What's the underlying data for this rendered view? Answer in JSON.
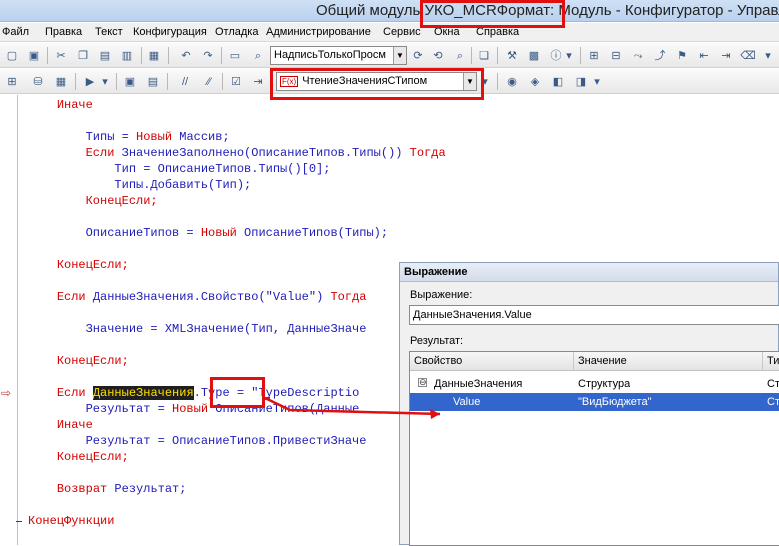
{
  "window": {
    "title": "Общий модуль УКО_MCRФормат: Модуль - Конфигуратор - Управлен"
  },
  "menu": [
    {
      "name": "menu-file",
      "label": "Файл"
    },
    {
      "name": "menu-edit",
      "label": "Правка"
    },
    {
      "name": "menu-text",
      "label": "Текст"
    },
    {
      "name": "menu-config",
      "label": "Конфигурация"
    },
    {
      "name": "menu-debug",
      "label": "Отладка"
    },
    {
      "name": "menu-admin",
      "label": "Администрирование"
    },
    {
      "name": "menu-service",
      "label": "Сервис"
    },
    {
      "name": "menu-windows",
      "label": "Окна"
    },
    {
      "name": "menu-help",
      "label": "Справка"
    }
  ],
  "toolbar": {
    "search_value": "НадписьТолькоПросм",
    "procedure_value": "ЧтениеЗначенияСТипом",
    "procedure_icon_text": "F(x)"
  },
  "code": {
    "lines": [
      {
        "indent": "    ",
        "parts": [
          {
            "t": "Иначе",
            "k": true
          }
        ]
      },
      {
        "indent": "",
        "parts": []
      },
      {
        "indent": "        ",
        "parts": [
          {
            "t": "Типы = ",
            "k": false
          },
          {
            "t": "Новый",
            "k": true
          },
          {
            "t": " Массив;",
            "k": false
          }
        ]
      },
      {
        "indent": "        ",
        "parts": [
          {
            "t": "Если",
            "k": true
          },
          {
            "t": " ЗначениеЗаполнено(ОписаниеТипов.Типы()) ",
            "k": false
          },
          {
            "t": "Тогда",
            "k": true
          }
        ]
      },
      {
        "indent": "            ",
        "parts": [
          {
            "t": "Тип = ОписаниеТипов.Типы()[0];",
            "k": false
          }
        ]
      },
      {
        "indent": "            ",
        "parts": [
          {
            "t": "Типы.Добавить(Тип);",
            "k": false
          }
        ]
      },
      {
        "indent": "        ",
        "parts": [
          {
            "t": "КонецЕсли;",
            "k": true
          }
        ]
      },
      {
        "indent": "",
        "parts": []
      },
      {
        "indent": "        ",
        "parts": [
          {
            "t": "ОписаниеТипов = ",
            "k": false
          },
          {
            "t": "Новый",
            "k": true
          },
          {
            "t": " ОписаниеТипов(Типы);",
            "k": false
          }
        ]
      },
      {
        "indent": "",
        "parts": []
      },
      {
        "indent": "    ",
        "parts": [
          {
            "t": "КонецЕсли;",
            "k": true
          }
        ]
      },
      {
        "indent": "",
        "parts": []
      },
      {
        "indent": "    ",
        "parts": [
          {
            "t": "Если",
            "k": true
          },
          {
            "t": " ДанныеЗначения.Свойство(",
            "k": false
          },
          {
            "t": "\"Value\"",
            "k": false
          },
          {
            "t": ") ",
            "k": false
          },
          {
            "t": "Тогда",
            "k": true
          }
        ]
      },
      {
        "indent": "",
        "parts": []
      },
      {
        "indent": "        ",
        "parts": [
          {
            "t": "Значение = XMLЗначение(Тип, ДанныеЗначе",
            "k": false
          }
        ]
      },
      {
        "indent": "",
        "parts": []
      },
      {
        "indent": "    ",
        "parts": [
          {
            "t": "КонецЕсли;",
            "k": true
          }
        ]
      },
      {
        "indent": "",
        "parts": []
      },
      {
        "indent": "    ",
        "parts": [
          {
            "t": "Если",
            "k": true
          },
          {
            "t": " ",
            "k": false
          },
          {
            "t": "ДанныеЗначения",
            "k": false,
            "h": true
          },
          {
            "t": ".Type = \"TypeDescriptio",
            "k": false
          }
        ]
      },
      {
        "indent": "        ",
        "parts": [
          {
            "t": "Результат = ",
            "k": false
          },
          {
            "t": "Новый",
            "k": true
          },
          {
            "t": " ОписаниеТипов(Данные",
            "k": false
          }
        ]
      },
      {
        "indent": "    ",
        "parts": [
          {
            "t": "Иначе",
            "k": true
          }
        ]
      },
      {
        "indent": "        ",
        "parts": [
          {
            "t": "Результат = ОписаниеТипов.ПривестиЗначе",
            "k": false
          }
        ]
      },
      {
        "indent": "    ",
        "parts": [
          {
            "t": "КонецЕсли;",
            "k": true
          }
        ]
      },
      {
        "indent": "",
        "parts": []
      },
      {
        "indent": "    ",
        "parts": [
          {
            "t": "Возврат",
            "k": true
          },
          {
            "t": " Результат;",
            "k": false
          }
        ]
      },
      {
        "indent": "",
        "parts": []
      },
      {
        "indent": "",
        "parts": [
          {
            "t": "КонецФункции",
            "k": true
          }
        ]
      }
    ]
  },
  "dialog": {
    "title": "Выражение",
    "expression_label": "Выражение:",
    "expression_value": "ДанныеЗначения.Value",
    "result_label": "Результат:",
    "columns": [
      "Свойство",
      "Значение",
      "Тип"
    ],
    "rows": [
      {
        "property": "ДанныеЗначения",
        "value": "Структура",
        "type": "Стр",
        "toggle": "⊖",
        "selected": false
      },
      {
        "property": "Value",
        "value": "\"ВидБюджета\"",
        "type": "Стр",
        "toggle": "",
        "selected": true
      }
    ]
  },
  "colors": {
    "keyword": "#d60000",
    "identifier": "#1c1cb8",
    "highlight_bg": "#1f1f1f",
    "highlight_fg": "#ffe100",
    "annotation": "#e01010",
    "selection": "#3366cc"
  }
}
